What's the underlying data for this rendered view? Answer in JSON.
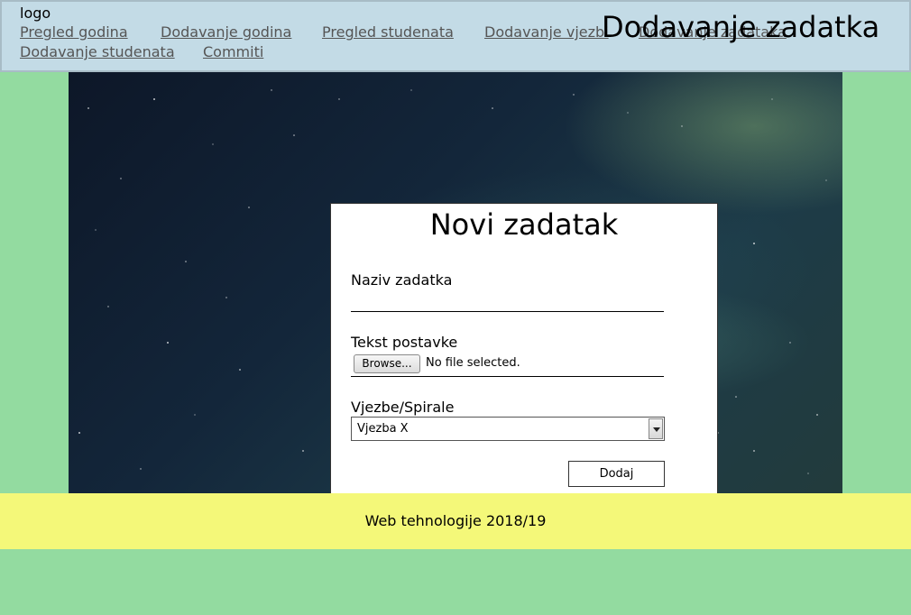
{
  "header": {
    "logo": "logo",
    "nav": [
      "Pregled godina",
      "Dodavanje godina",
      "Pregled studenata",
      "Dodavanje vjezbi",
      "Dodavanje zadataka",
      "Dodavanje studenata",
      "Commiti"
    ],
    "page_heading": "Dodavanje zadatka"
  },
  "form": {
    "title": "Novi zadatak",
    "name_label": "Naziv zadatka",
    "name_value": "",
    "text_label": "Tekst postavke",
    "browse_label": "Browse...",
    "file_status": "No file selected.",
    "select_label": "Vjezbe/Spirale",
    "select_value": "Vjezba X",
    "submit_label": "Dodaj"
  },
  "footer": {
    "text": "Web tehnologije 2018/19"
  },
  "colors": {
    "page_bg": "#93dba0",
    "header_bg": "#c3dbe6",
    "footer_bg": "#f4f879"
  }
}
